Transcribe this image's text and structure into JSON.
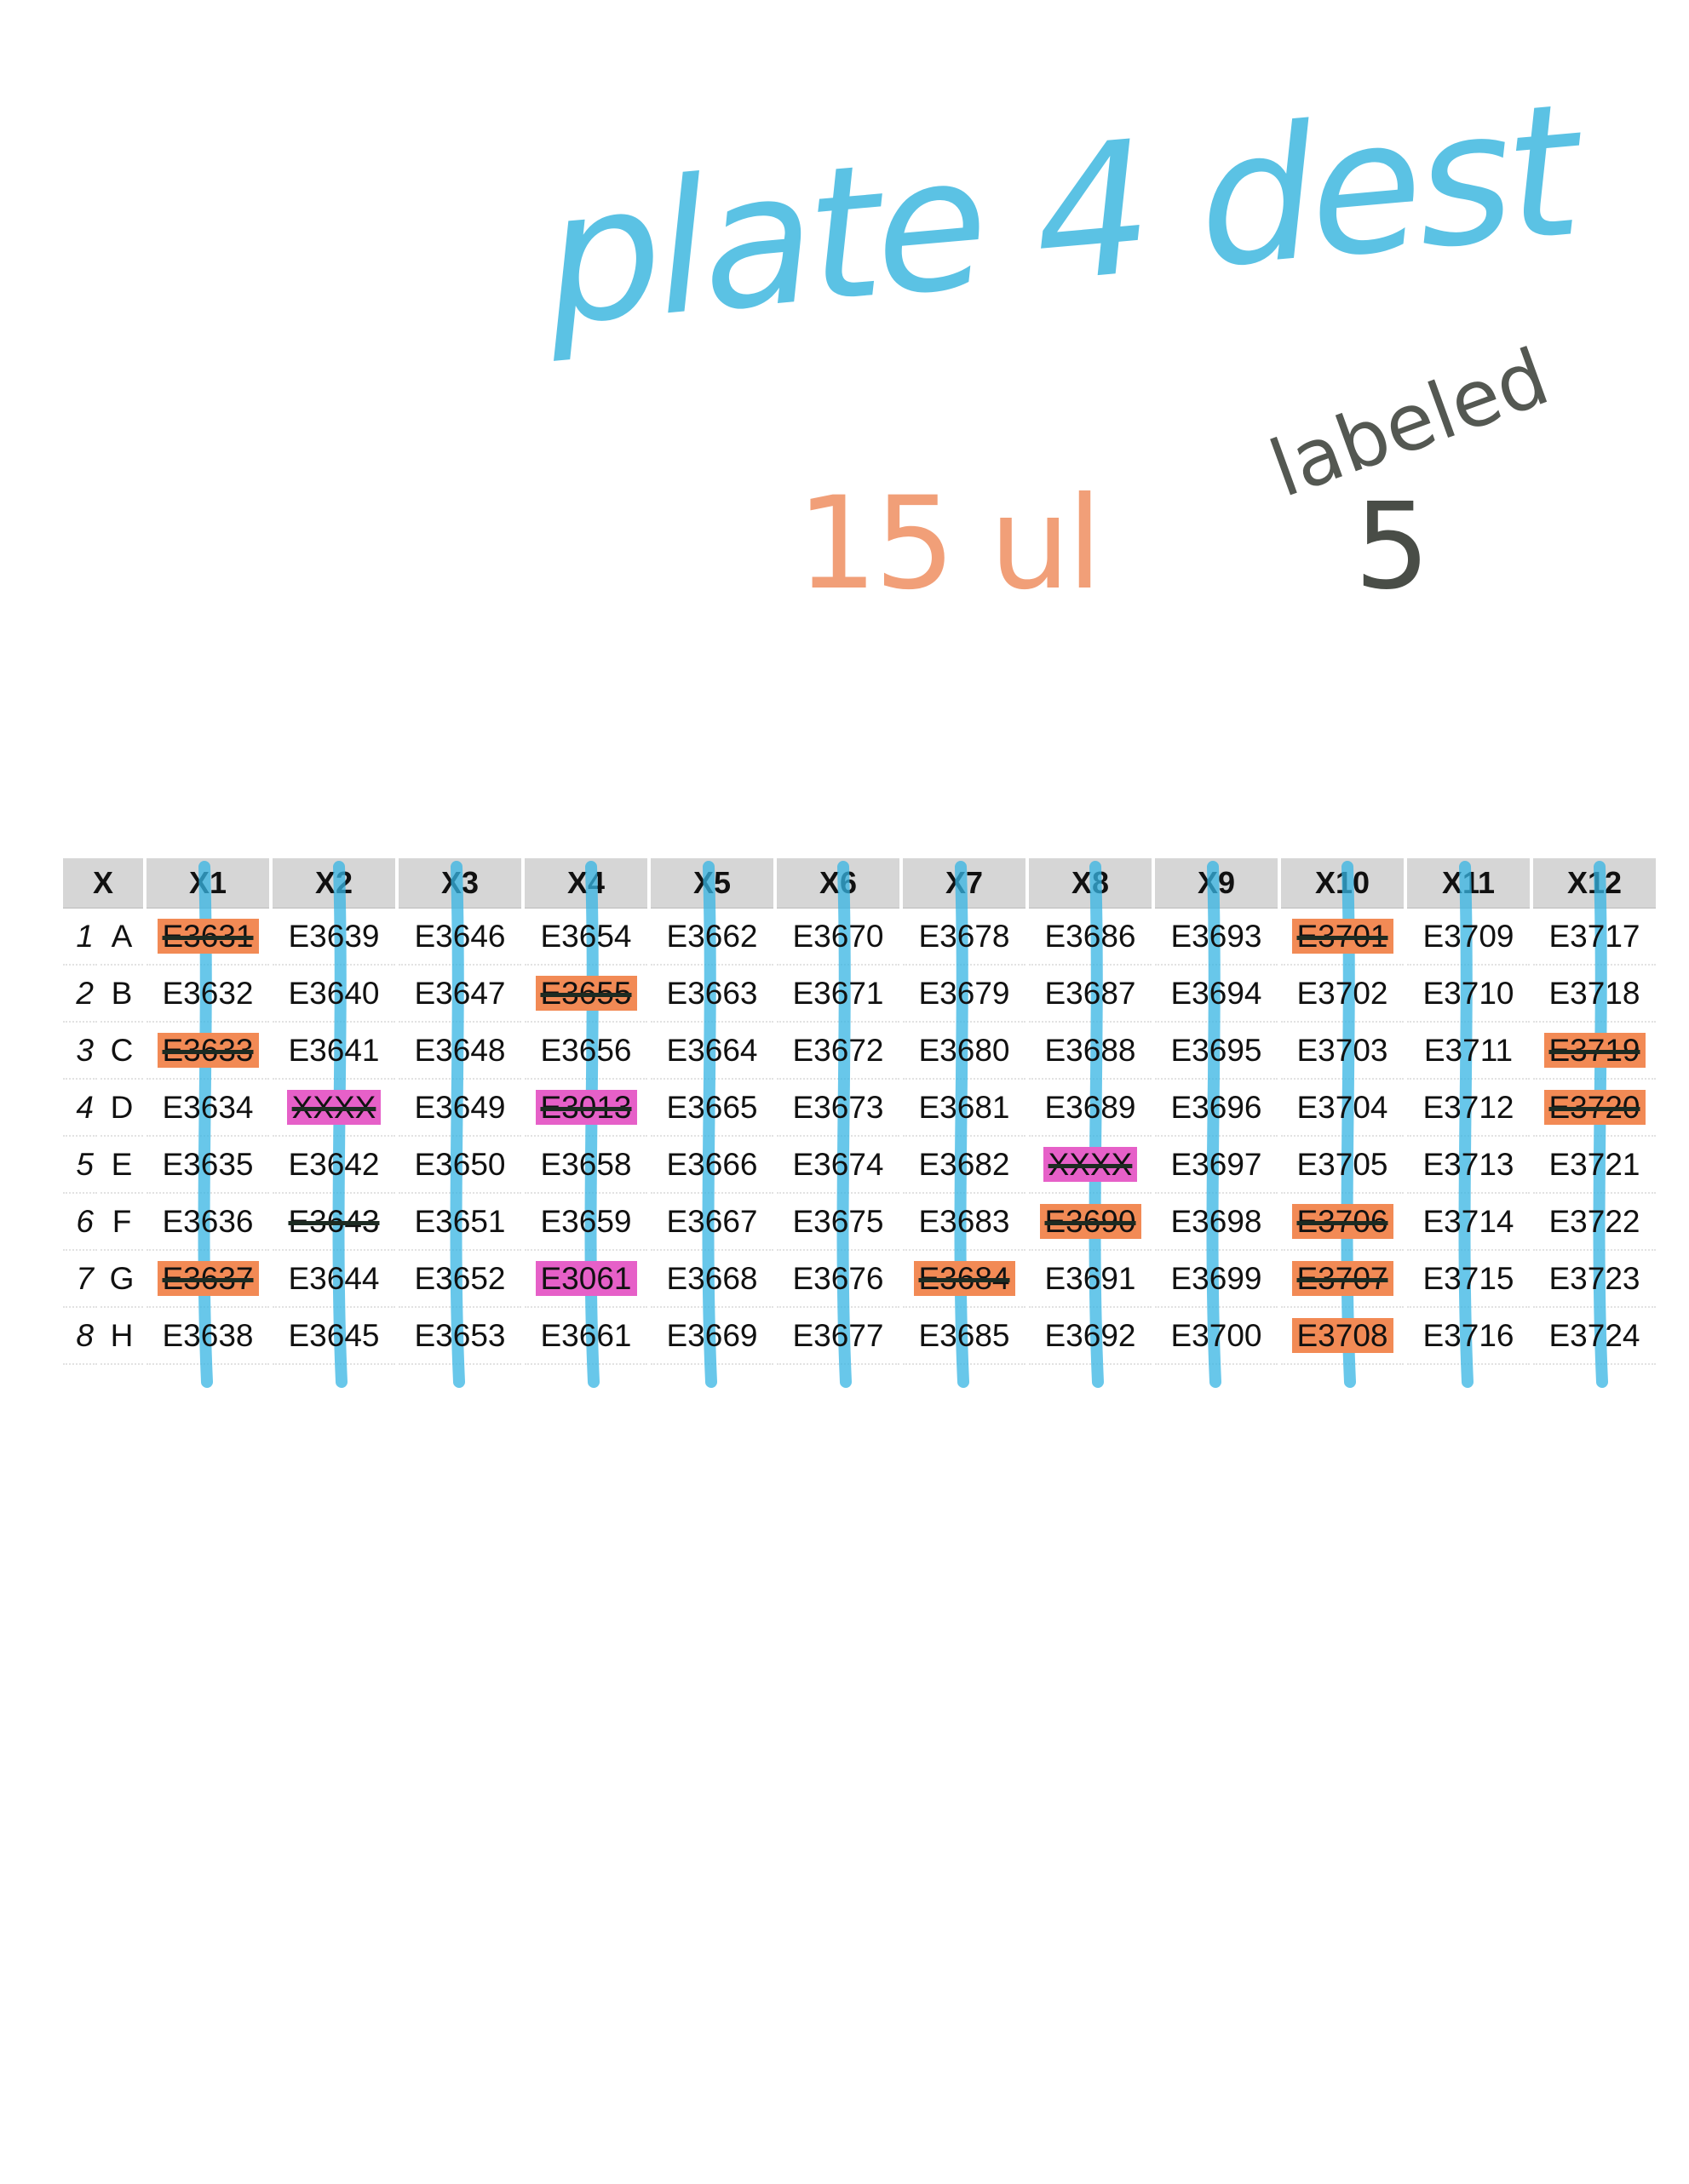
{
  "annotations": {
    "title": "plate 4 dest",
    "volume": "15 ul",
    "label_note": "labeled",
    "label_number": "5"
  },
  "colors": {
    "title_ink": "#3fb8e0",
    "volume_ink": "#f0956a",
    "pencil": "#2a2f28",
    "column_mark": "#35b4e3",
    "highlight_orange": "#f28a55",
    "highlight_pink": "#e660c8",
    "strike": "#1d2b22"
  },
  "table": {
    "corner": "X",
    "columns": [
      "X1",
      "X2",
      "X3",
      "X4",
      "X5",
      "X6",
      "X7",
      "X8",
      "X9",
      "X10",
      "X11",
      "X12"
    ],
    "rows": [
      {
        "num": "1",
        "letter": "A",
        "cells": [
          "E3631",
          "E3639",
          "E3646",
          "E3654",
          "E3662",
          "E3670",
          "E3678",
          "E3686",
          "E3693",
          "E3701",
          "E3709",
          "E3717"
        ]
      },
      {
        "num": "2",
        "letter": "B",
        "cells": [
          "E3632",
          "E3640",
          "E3647",
          "E3655",
          "E3663",
          "E3671",
          "E3679",
          "E3687",
          "E3694",
          "E3702",
          "E3710",
          "E3718"
        ]
      },
      {
        "num": "3",
        "letter": "C",
        "cells": [
          "E3633",
          "E3641",
          "E3648",
          "E3656",
          "E3664",
          "E3672",
          "E3680",
          "E3688",
          "E3695",
          "E3703",
          "E3711",
          "E3719"
        ]
      },
      {
        "num": "4",
        "letter": "D",
        "cells": [
          "E3634",
          "XXXX",
          "E3649",
          "E3013",
          "E3665",
          "E3673",
          "E3681",
          "E3689",
          "E3696",
          "E3704",
          "E3712",
          "E3720"
        ]
      },
      {
        "num": "5",
        "letter": "E",
        "cells": [
          "E3635",
          "E3642",
          "E3650",
          "E3658",
          "E3666",
          "E3674",
          "E3682",
          "XXXX",
          "E3697",
          "E3705",
          "E3713",
          "E3721"
        ]
      },
      {
        "num": "6",
        "letter": "F",
        "cells": [
          "E3636",
          "E3643",
          "E3651",
          "E3659",
          "E3667",
          "E3675",
          "E3683",
          "E3690",
          "E3698",
          "E3706",
          "E3714",
          "E3722"
        ]
      },
      {
        "num": "7",
        "letter": "G",
        "cells": [
          "E3637",
          "E3644",
          "E3652",
          "E3061",
          "E3668",
          "E3676",
          "E3684",
          "E3691",
          "E3699",
          "E3707",
          "E3715",
          "E3723"
        ]
      },
      {
        "num": "8",
        "letter": "H",
        "cells": [
          "E3638",
          "E3645",
          "E3653",
          "E3661",
          "E3669",
          "E3677",
          "E3685",
          "E3692",
          "E3700",
          "E3708",
          "E3716",
          "E3724"
        ]
      }
    ],
    "marks": {
      "orange": [
        [
          0,
          0
        ],
        [
          2,
          0
        ],
        [
          6,
          0
        ],
        [
          1,
          3
        ],
        [
          6,
          6
        ],
        [
          5,
          7
        ],
        [
          0,
          9
        ],
        [
          5,
          9
        ],
        [
          6,
          9
        ],
        [
          7,
          9
        ],
        [
          2,
          11
        ],
        [
          3,
          11
        ]
      ],
      "pink": [
        [
          3,
          1
        ],
        [
          3,
          3
        ],
        [
          4,
          7
        ],
        [
          6,
          3
        ]
      ],
      "struck": [
        [
          0,
          0
        ],
        [
          2,
          0
        ],
        [
          6,
          0
        ],
        [
          3,
          1
        ],
        [
          5,
          1
        ],
        [
          1,
          3
        ],
        [
          3,
          3
        ],
        [
          6,
          6
        ],
        [
          4,
          7
        ],
        [
          5,
          7
        ],
        [
          0,
          9
        ],
        [
          5,
          9
        ],
        [
          6,
          9
        ],
        [
          2,
          11
        ],
        [
          3,
          11
        ]
      ]
    }
  }
}
